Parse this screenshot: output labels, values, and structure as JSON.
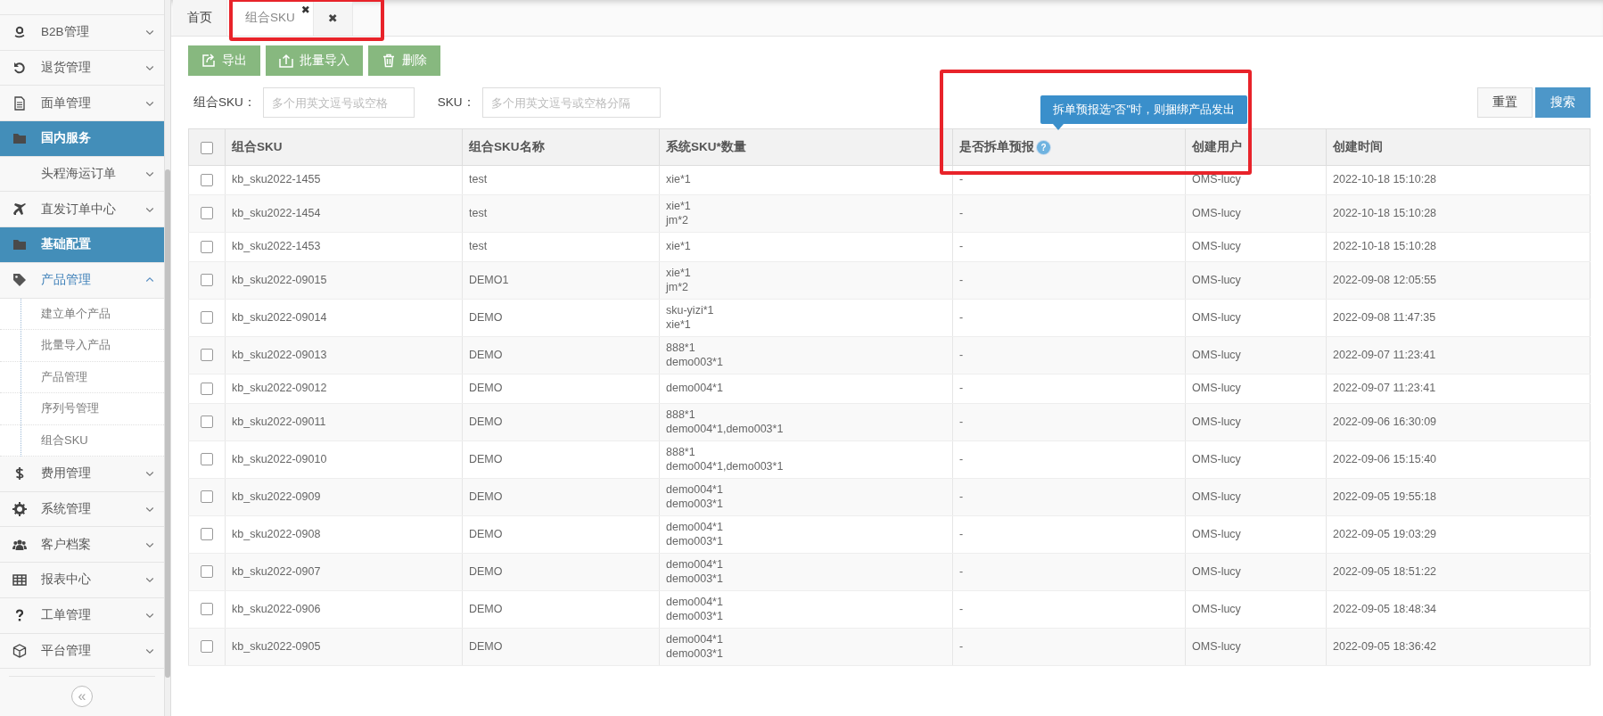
{
  "sidebar": {
    "items": [
      {
        "label": "B2B管理",
        "kind": "menu",
        "expanded": false
      },
      {
        "label": "退货管理",
        "kind": "menu",
        "expanded": false
      },
      {
        "label": "面单管理",
        "kind": "menu",
        "expanded": false
      },
      {
        "label": "国内服务",
        "kind": "section"
      },
      {
        "label": "头程海运订单",
        "kind": "menu",
        "expanded": false
      },
      {
        "label": "直发订单中心",
        "kind": "menu",
        "expanded": false
      },
      {
        "label": "基础配置",
        "kind": "section"
      },
      {
        "label": "产品管理",
        "kind": "menu",
        "expanded": true,
        "children": [
          {
            "label": "建立单个产品",
            "selected": false
          },
          {
            "label": "批量导入产品",
            "selected": false
          },
          {
            "label": "产品管理",
            "selected": false
          },
          {
            "label": "序列号管理",
            "selected": false
          },
          {
            "label": "组合SKU",
            "selected": false
          }
        ]
      },
      {
        "label": "费用管理",
        "kind": "menu",
        "expanded": false
      },
      {
        "label": "系统管理",
        "kind": "menu",
        "expanded": false
      },
      {
        "label": "客户档案",
        "kind": "menu",
        "expanded": false
      },
      {
        "label": "报表中心",
        "kind": "menu",
        "expanded": false
      },
      {
        "label": "工单管理",
        "kind": "menu",
        "expanded": false
      },
      {
        "label": "平台管理",
        "kind": "menu",
        "expanded": false
      }
    ],
    "collapse": "«"
  },
  "tabs": [
    {
      "label": "首页",
      "selected": false
    },
    {
      "label": "组合SKU",
      "selected": true,
      "close": "✖"
    }
  ],
  "close_all": "✖",
  "toolbar": [
    "导出",
    "批量导入",
    "删除"
  ],
  "filters": [
    {
      "label": "组合SKU：",
      "placeholder": "多个用英文逗号或空格"
    },
    {
      "label": "SKU：",
      "placeholder": "多个用英文逗号或空格分隔"
    }
  ],
  "actions": [
    {
      "label": "重置",
      "kind": "default"
    },
    {
      "label": "搜索",
      "kind": "primary"
    }
  ],
  "tooltip": "拆单预报选\"否\"时，则捆绑产品发出",
  "table": {
    "select_all_checked": false,
    "columns": [
      {
        "label": "组合SKU"
      },
      {
        "label": "组合SKU名称"
      },
      {
        "label": "系统SKU*数量"
      },
      {
        "label": "是否拆单预报",
        "help": "?"
      },
      {
        "label": "创建用户"
      },
      {
        "label": "创建时间"
      }
    ],
    "rows": [
      {
        "checked": false,
        "cells": [
          "kb_sku2022-1455",
          "test",
          [
            "xie*1"
          ],
          "-",
          "OMS-lucy",
          "2022-10-18 15:10:28"
        ]
      },
      {
        "checked": false,
        "cells": [
          "kb_sku2022-1454",
          "test",
          [
            "xie*1",
            "jm*2"
          ],
          "-",
          "OMS-lucy",
          "2022-10-18 15:10:28"
        ]
      },
      {
        "checked": false,
        "cells": [
          "kb_sku2022-1453",
          "test",
          [
            "xie*1"
          ],
          "-",
          "OMS-lucy",
          "2022-10-18 15:10:28"
        ]
      },
      {
        "checked": false,
        "cells": [
          "kb_sku2022-09015",
          "DEMO1",
          [
            "xie*1",
            "jm*2"
          ],
          "-",
          "OMS-lucy",
          "2022-09-08 12:05:55"
        ]
      },
      {
        "checked": false,
        "cells": [
          "kb_sku2022-09014",
          "DEMO",
          [
            "sku-yizi*1",
            "xie*1"
          ],
          "-",
          "OMS-lucy",
          "2022-09-08 11:47:35"
        ]
      },
      {
        "checked": false,
        "cells": [
          "kb_sku2022-09013",
          "DEMO",
          [
            "888*1",
            "demo003*1"
          ],
          "-",
          "OMS-lucy",
          "2022-09-07 11:23:41"
        ]
      },
      {
        "checked": false,
        "cells": [
          "kb_sku2022-09012",
          "DEMO",
          [
            "demo004*1"
          ],
          "-",
          "OMS-lucy",
          "2022-09-07 11:23:41"
        ]
      },
      {
        "checked": false,
        "cells": [
          "kb_sku2022-09011",
          "DEMO",
          [
            "888*1",
            "demo004*1,demo003*1"
          ],
          "-",
          "OMS-lucy",
          "2022-09-06 16:30:09"
        ]
      },
      {
        "checked": false,
        "cells": [
          "kb_sku2022-09010",
          "DEMO",
          [
            "888*1",
            "demo004*1,demo003*1"
          ],
          "-",
          "OMS-lucy",
          "2022-09-06 15:15:40"
        ]
      },
      {
        "checked": false,
        "cells": [
          "kb_sku2022-0909",
          "DEMO",
          [
            "demo004*1",
            "demo003*1"
          ],
          "-",
          "OMS-lucy",
          "2022-09-05 19:55:18"
        ]
      },
      {
        "checked": false,
        "cells": [
          "kb_sku2022-0908",
          "DEMO",
          [
            "demo004*1",
            "demo003*1"
          ],
          "-",
          "OMS-lucy",
          "2022-09-05 19:03:29"
        ]
      },
      {
        "checked": false,
        "cells": [
          "kb_sku2022-0907",
          "DEMO",
          [
            "demo004*1",
            "demo003*1"
          ],
          "-",
          "OMS-lucy",
          "2022-09-05 18:51:22"
        ]
      },
      {
        "checked": false,
        "cells": [
          "kb_sku2022-0906",
          "DEMO",
          [
            "demo004*1",
            "demo003*1"
          ],
          "-",
          "OMS-lucy",
          "2022-09-05 18:48:34"
        ]
      },
      {
        "checked": false,
        "cells": [
          "kb_sku2022-0905",
          "DEMO",
          [
            "demo004*1",
            "demo003*1"
          ],
          "-",
          "OMS-lucy",
          "2022-09-05 18:36:42"
        ]
      }
    ]
  }
}
